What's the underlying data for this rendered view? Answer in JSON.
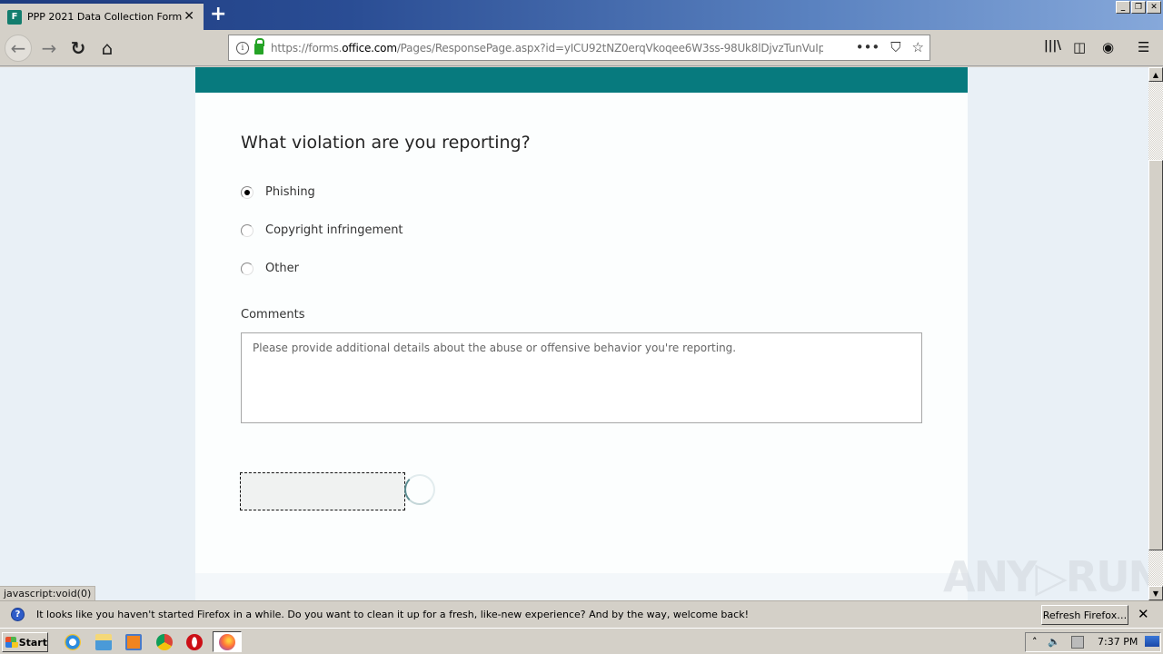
{
  "browser": {
    "tab": {
      "title": "PPP 2021 Data Collection Form",
      "icon": "forms-icon",
      "close_icon": "close-icon"
    },
    "new_tab_icon": "plus-icon",
    "window_controls": {
      "minimize": "_",
      "restore": "❐",
      "close": "✕"
    },
    "nav": {
      "back_icon": "←",
      "forward_icon": "→",
      "reload_icon": "↻",
      "home_icon": "⌂"
    },
    "url": {
      "prefix": "https://forms.",
      "domain": "office.com",
      "suffix": "/Pages/ResponsePage.aspx?id=yICU92tNZ0erqVkoqee6W3ss-98Uk8lDjvzTunVuIpR",
      "info_icon": "i",
      "page_actions_icon": "•••",
      "pocket_icon": "⛉",
      "bookmark_icon": "☆"
    },
    "toolbar_right": {
      "library_icon": "|||\\",
      "sidebar_icon": "◫",
      "account_icon": "◉",
      "menu_icon": "☰"
    },
    "status_link": "javascript:void(0)"
  },
  "form": {
    "question": "What violation are you reporting?",
    "options": [
      {
        "label": "Phishing",
        "checked": true
      },
      {
        "label": "Copyright infringement",
        "checked": false
      },
      {
        "label": "Other",
        "checked": false
      }
    ],
    "comments_label": "Comments",
    "comments_placeholder": "Please provide additional details about the abuse or offensive behavior you're reporting.",
    "comments_value": "",
    "submit_label": "",
    "state": "loading"
  },
  "colors": {
    "header_band": "#077a7e",
    "page_bg": "#e9f0f6"
  },
  "notification": {
    "icon": "?",
    "text": "It looks like you haven't started Firefox in a while. Do you want to clean it up for a fresh, like-new experience? And by the way, welcome back!",
    "button_label": "Refresh Firefox…",
    "close_icon": "✕"
  },
  "watermark": "ANY▷RUN",
  "taskbar": {
    "start_label": "Start",
    "apps": [
      "internet-explorer",
      "file-explorer",
      "media-player",
      "chrome",
      "opera",
      "firefox"
    ],
    "tray": {
      "expand_icon": "˄",
      "volume_icon": "🔈",
      "network_icon": "network-warning",
      "time": "7:37 PM"
    }
  }
}
